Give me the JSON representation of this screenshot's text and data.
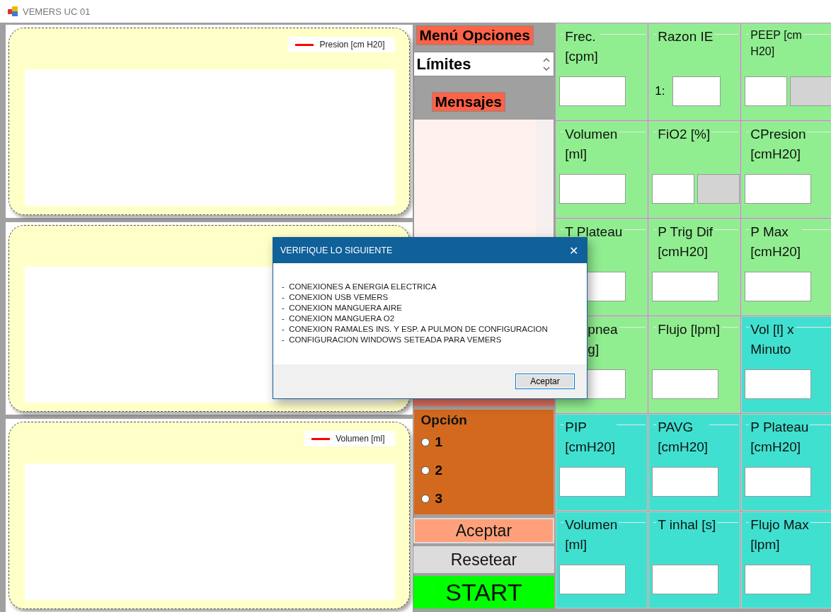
{
  "window": {
    "title": "VEMERS UC 01"
  },
  "charts": [
    {
      "kind": "legend",
      "legend": "Presion [cm H20]"
    },
    {
      "kind": "plain"
    },
    {
      "kind": "legend",
      "legend": "Volumen [ml]"
    }
  ],
  "menu": {
    "title": "Menú Opciones",
    "selector": "Límites",
    "messages_title": "Mensajes"
  },
  "option_group": {
    "title": "Opción",
    "options": [
      {
        "label": "1",
        "selected": false
      },
      {
        "label": "2",
        "selected": false
      },
      {
        "label": "3",
        "selected": false
      }
    ]
  },
  "buttons": [
    {
      "label": "Aceptar",
      "kind": "accept"
    },
    {
      "label": "Resetear",
      "kind": "reset"
    },
    {
      "label": "START",
      "kind": "start"
    }
  ],
  "parameters": [
    {
      "label": "Frec.\n[cpm]",
      "kind": "single",
      "color": "#90ee90"
    },
    {
      "label": "Razon IE",
      "kind": "prefixed",
      "prefix": "1:",
      "color": "#90ee90"
    },
    {
      "label": "PEEP   [cm\nH20]",
      "kind": "pair",
      "color": "#90ee90",
      "small": true
    },
    {
      "label": "Volumen\n[ml]",
      "kind": "single",
      "color": "#90ee90"
    },
    {
      "label": "FiO2 [%]",
      "kind": "pair",
      "color": "#90ee90"
    },
    {
      "label": "CPresion\n[cmH20]",
      "kind": "single",
      "color": "#90ee90"
    },
    {
      "label": "T Plateau",
      "kind": "single",
      "color": "#90ee90"
    },
    {
      "label": "P Trig Dif\n[cmH20]",
      "kind": "single",
      "color": "#90ee90"
    },
    {
      "label": "P Max\n[cmH20]",
      "kind": "single",
      "color": "#90ee90"
    },
    {
      "label": "pnea\ng]",
      "kind": "covered",
      "color": "#90ee90"
    },
    {
      "label": "Flujo [lpm]",
      "kind": "single",
      "color": "#90ee90"
    },
    {
      "label": "Vol [l] x\nMinuto",
      "kind": "single",
      "color": "#40e0d0"
    },
    {
      "label": "PIP\n[cmH20]",
      "kind": "single",
      "color": "#40e0d0"
    },
    {
      "label": "PAVG\n[cmH20]",
      "kind": "single",
      "color": "#40e0d0"
    },
    {
      "label": "P Plateau\n[cmH20]",
      "kind": "single",
      "color": "#40e0d0"
    },
    {
      "label": "Volumen\n[ml]",
      "kind": "single",
      "color": "#40e0d0"
    },
    {
      "label": "T inhal [s]",
      "kind": "single",
      "color": "#40e0d0"
    },
    {
      "label": "Flujo Max\n[lpm]",
      "kind": "single",
      "color": "#40e0d0"
    }
  ],
  "dialog": {
    "title": "VERIFIQUE LO SIGUIENTE",
    "close": "✕",
    "items": [
      "-  CONEXIONES A ENERGIA ELECTRICA",
      "-  CONEXION USB VEMERS",
      "-  CONEXION MANGUERA AIRE",
      "-  CONEXION MANGUERA O2",
      "-  CONEXION RAMALES INS. Y ESP. A PULMON DE CONFIGURACION",
      "-  CONFIGURACION WINDOWS SETEADA PARA VEMERS"
    ],
    "button": "Aceptar"
  }
}
